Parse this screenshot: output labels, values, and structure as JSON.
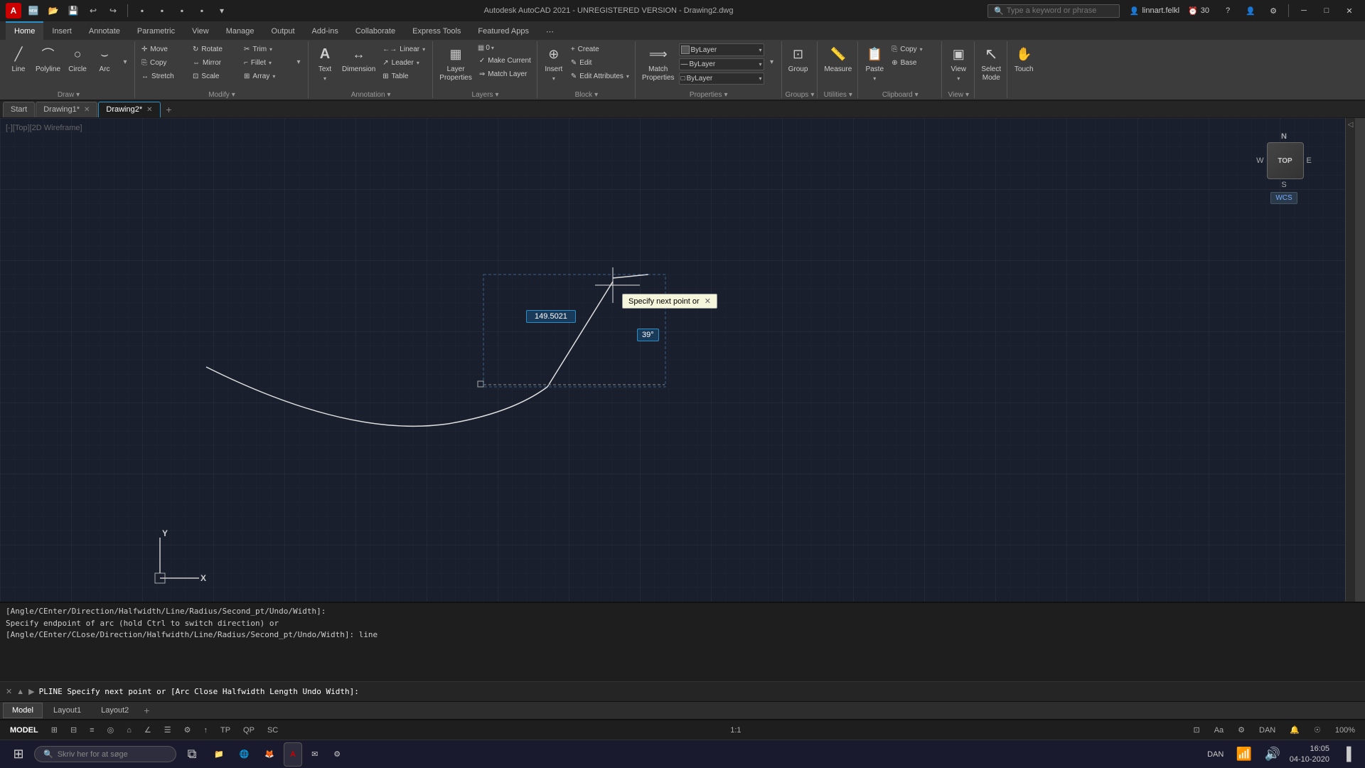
{
  "titlebar": {
    "app_name": "Autodesk AutoCAD 2021 - UNREGISTERED VERSION - Drawing2.dwg",
    "search_placeholder": "Type a keyword or phrase",
    "user": "linnart.felkl",
    "time": "30",
    "minimize": "─",
    "maximize": "□",
    "close": "✕",
    "logo": "A"
  },
  "qat": {
    "buttons": [
      "🆕",
      "📂",
      "💾",
      "↩",
      "↪",
      "⬛",
      "⬛",
      "⬛",
      "⬛"
    ]
  },
  "ribbon": {
    "tabs": [
      "Home",
      "Insert",
      "Annotate",
      "Parametric",
      "View",
      "Manage",
      "Output",
      "Add-ins",
      "Collaborate",
      "Express Tools",
      "Featured Apps",
      "⋯"
    ],
    "active_tab": "Home",
    "groups": [
      {
        "name": "Draw",
        "items": [
          {
            "type": "big",
            "label": "Line",
            "icon": "╱"
          },
          {
            "type": "big",
            "label": "Polyline",
            "icon": "⌒"
          },
          {
            "type": "big",
            "label": "Circle",
            "icon": "○"
          },
          {
            "type": "big",
            "label": "Arc",
            "icon": "⌣"
          }
        ]
      },
      {
        "name": "Modify",
        "items": [
          {
            "type": "small",
            "label": "Move",
            "icon": "✛"
          },
          {
            "type": "small",
            "label": "Rotate",
            "icon": "↻"
          },
          {
            "type": "small",
            "label": "Trim",
            "icon": "✂"
          },
          {
            "type": "small",
            "label": "Copy",
            "icon": "⎘"
          },
          {
            "type": "small",
            "label": "Mirror",
            "icon": "⇔"
          },
          {
            "type": "small",
            "label": "Fillet",
            "icon": "⌐"
          },
          {
            "type": "small",
            "label": "Stretch",
            "icon": "↔"
          },
          {
            "type": "small",
            "label": "Scale",
            "icon": "⊡"
          },
          {
            "type": "small",
            "label": "Array",
            "icon": "⊞"
          }
        ]
      },
      {
        "name": "Annotation",
        "items": [
          {
            "type": "big",
            "label": "Text",
            "icon": "A"
          },
          {
            "type": "big",
            "label": "Dimension",
            "icon": "↔"
          },
          {
            "type": "small",
            "label": "Linear",
            "icon": "←"
          },
          {
            "type": "small",
            "label": "Leader",
            "icon": "↗"
          },
          {
            "type": "small",
            "label": "Table",
            "icon": "⊞"
          }
        ]
      },
      {
        "name": "Layers",
        "items": [
          {
            "type": "big",
            "label": "Layer\nProperties",
            "icon": "▦"
          },
          {
            "type": "small",
            "label": "Make Current",
            "icon": "✓"
          },
          {
            "type": "small",
            "label": "Match Layer",
            "icon": "⇒"
          }
        ]
      },
      {
        "name": "Block",
        "items": [
          {
            "type": "big",
            "label": "Insert",
            "icon": "⊕"
          },
          {
            "type": "small",
            "label": "Create",
            "icon": "+"
          },
          {
            "type": "small",
            "label": "Edit",
            "icon": "✎"
          },
          {
            "type": "small",
            "label": "Edit Attributes",
            "icon": "✎"
          }
        ]
      },
      {
        "name": "Properties",
        "items": [
          {
            "type": "big",
            "label": "Match\nProperties",
            "icon": "⟹"
          },
          {
            "type": "dropdown",
            "label": "ByLayer",
            "icon": "▦"
          },
          {
            "type": "dropdown",
            "label": "ByLayer",
            "icon": "—"
          },
          {
            "type": "dropdown",
            "label": "ByLayer",
            "icon": "□"
          }
        ]
      },
      {
        "name": "Groups",
        "items": [
          {
            "type": "big",
            "label": "Group",
            "icon": "⊡"
          }
        ]
      },
      {
        "name": "Utilities",
        "items": [
          {
            "type": "big",
            "label": "Measure",
            "icon": "📏"
          }
        ]
      },
      {
        "name": "Clipboard",
        "items": [
          {
            "type": "big",
            "label": "Paste",
            "icon": "📋"
          },
          {
            "type": "small",
            "label": "Copy",
            "icon": "⎘"
          },
          {
            "type": "small",
            "label": "Base",
            "icon": "⊕"
          }
        ]
      },
      {
        "name": "View",
        "items": [
          {
            "type": "big",
            "label": "Select\nMode",
            "icon": "↖"
          }
        ]
      },
      {
        "name": "Touch",
        "items": [
          {
            "type": "big",
            "label": "Touch",
            "icon": "✋"
          }
        ]
      }
    ]
  },
  "doc_tabs": [
    {
      "label": "Start",
      "closeable": false,
      "active": false
    },
    {
      "label": "Drawing1*",
      "closeable": true,
      "active": false
    },
    {
      "label": "Drawing2*",
      "closeable": true,
      "active": true
    }
  ],
  "viewport": {
    "label": "[-][Top][2D Wireframe]",
    "compass": {
      "n": "N",
      "s": "S",
      "e": "E",
      "w": "W",
      "top_label": "TOP"
    },
    "wcs_label": "WCS",
    "ucs_x": "X",
    "ucs_y": "Y"
  },
  "drawing": {
    "tooltip_text": "Specify next point or",
    "input_value": "149.5021",
    "angle_value": "39°"
  },
  "command_history": [
    "[Angle/CEnter/Direction/Halfwidth/Line/Radius/Second_pt/Undo/Width]:",
    "Specify endpoint of arc (hold Ctrl to switch direction) or",
    "[Angle/CEnter/CLose/Direction/Halfwidth/Line/Radius/Second_pt/Undo/Width]: line"
  ],
  "command_prompt": "PLINE Specify next point or [Arc Close Halfwidth Length Undo Width]:",
  "model_tabs": [
    {
      "label": "Model",
      "active": true
    },
    {
      "label": "Layout1",
      "active": false
    },
    {
      "label": "Layout2",
      "active": false
    }
  ],
  "statusbar": {
    "model_label": "MODEL",
    "buttons": [
      "⊞",
      "⊟",
      "≡",
      "◎",
      "⌂",
      "∠",
      "☰",
      "⚙",
      "↑"
    ],
    "zoom_level": "1:1",
    "view_label": "100%",
    "os_label": "DAN"
  },
  "taskbar": {
    "start_label": "⊞",
    "search_placeholder": "Skriv her for at søge",
    "time": "16:05",
    "date": "04-10-2020",
    "apps": [
      {
        "icon": "🖥",
        "label": ""
      },
      {
        "icon": "🔍",
        "label": ""
      },
      {
        "icon": "📋",
        "label": ""
      },
      {
        "icon": "🖥",
        "label": ""
      },
      {
        "icon": "📁",
        "label": ""
      },
      {
        "icon": "🌐",
        "label": ""
      },
      {
        "icon": "🦊",
        "label": ""
      },
      {
        "icon": "A",
        "label": ""
      },
      {
        "icon": "✉",
        "label": ""
      },
      {
        "icon": "⚙",
        "label": ""
      }
    ]
  }
}
